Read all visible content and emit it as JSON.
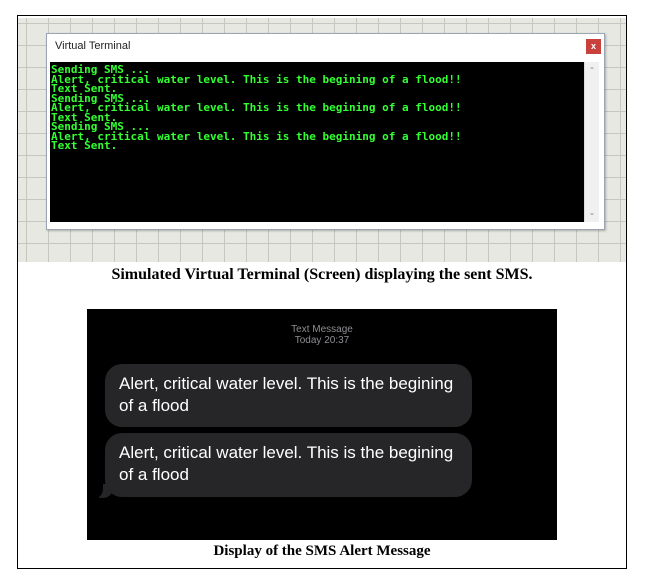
{
  "terminal": {
    "window_title": "Virtual Terminal",
    "close_label": "x",
    "lines": [
      "Sending SMS ...",
      "Alert, critical water level. This is the begining of a flood!!",
      "Text Sent.",
      "Sending SMS ...",
      "Alert, critical water level. This is the begining of a flood!!",
      "Text Sent.",
      "Sending SMS ...",
      "Alert, critical water level. This is the begining of a flood!!",
      "Text Sent."
    ],
    "text_color": "#33ff33",
    "background_color": "#000000"
  },
  "caption_top": "Simulated Virtual Terminal (Screen) displaying the sent SMS.",
  "phone": {
    "message_kind": "Text Message",
    "message_time": "Today 20:37",
    "messages": [
      "Alert, critical water level. This is the begining of a flood",
      "Alert, critical water level. This is the begining of a flood"
    ],
    "bubble_color": "#262628"
  },
  "caption_bottom": "Display of the SMS Alert Message"
}
